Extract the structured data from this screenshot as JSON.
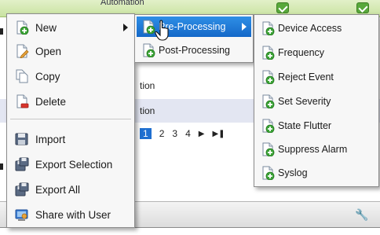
{
  "background": {
    "top_strip_text": "Automation",
    "rows": [
      "tion",
      "tion"
    ],
    "pager": [
      "1",
      "2",
      "3",
      "4"
    ]
  },
  "context_menu": {
    "items": [
      {
        "label": "New",
        "icon": "new-document-icon",
        "submenu": true
      },
      {
        "label": "Open",
        "icon": "open-document-icon"
      },
      {
        "label": "Copy",
        "icon": "copy-document-icon"
      },
      {
        "label": "Delete",
        "icon": "delete-document-icon"
      },
      {
        "label": "Import",
        "icon": "import-icon"
      },
      {
        "label": "Export Selection",
        "icon": "export-selection-icon"
      },
      {
        "label": "Export All",
        "icon": "export-all-icon"
      },
      {
        "label": "Share with User",
        "icon": "share-user-icon"
      }
    ]
  },
  "submenu_new": {
    "items": [
      {
        "label": "Pre-Processing",
        "icon": "new-document-icon",
        "submenu": true,
        "highlighted": true
      },
      {
        "label": "Post-Processing",
        "icon": "new-document-icon"
      }
    ]
  },
  "submenu_preprocessing": {
    "items": [
      {
        "label": "Device Access",
        "icon": "new-document-icon"
      },
      {
        "label": "Frequency",
        "icon": "new-document-icon"
      },
      {
        "label": "Reject Event",
        "icon": "new-document-icon"
      },
      {
        "label": "Set Severity",
        "icon": "new-document-icon"
      },
      {
        "label": "State Flutter",
        "icon": "new-document-icon"
      },
      {
        "label": "Suppress Alarm",
        "icon": "new-document-icon"
      },
      {
        "label": "Syslog",
        "icon": "new-document-icon"
      }
    ]
  },
  "colors": {
    "highlight": "#1f7fd9",
    "plus_green": "#3aa335"
  }
}
